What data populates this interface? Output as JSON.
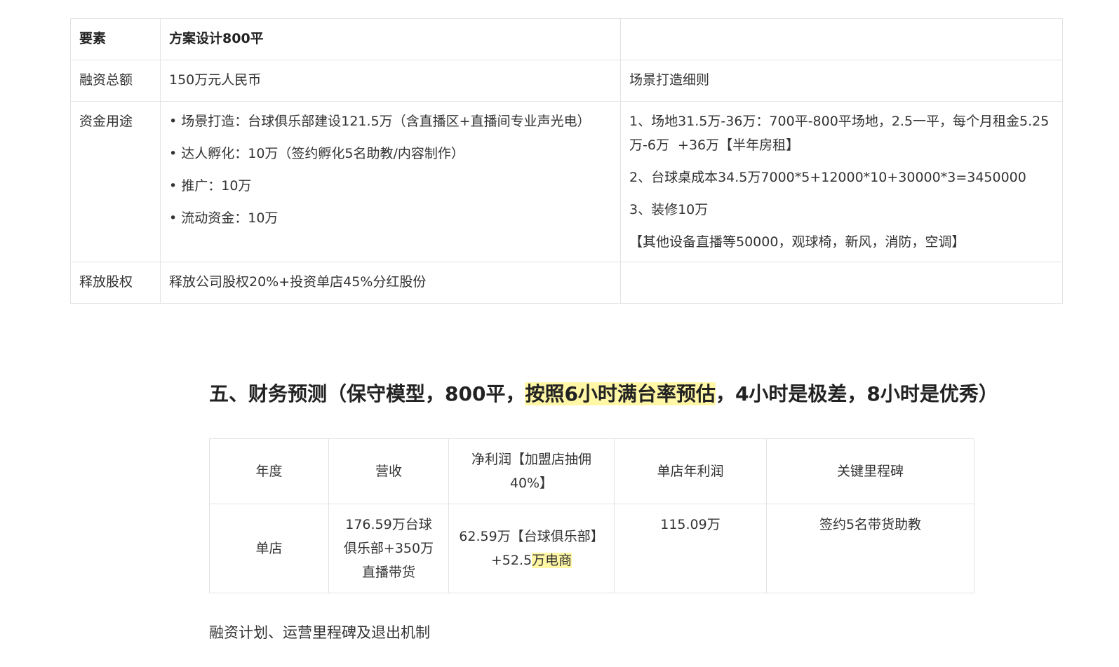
{
  "table1": {
    "header": {
      "c1": "要素",
      "c2": "方案设计800平",
      "c3": ""
    },
    "rows": {
      "total": {
        "label": "融资总额",
        "value": "150万元人民币",
        "detail": "场景打造细则"
      },
      "uses": {
        "label": "资金用途",
        "items": [
          "场景打造：台球俱乐部建设121.5万（含直播区+直播间专业声光电）",
          "达人孵化：10万（签约孵化5名助教/内容制作）",
          "推广：10万",
          "流动资金：10万"
        ],
        "details": [
          "1、场地31.5万-36万：700平-800平场地，2.5一平，每个月租金5.25万-6万  +36万【半年房租】",
          "2、台球桌成本34.5万7000*5+12000*10+30000*3=3450000",
          "3、装修10万",
          "【其他设备直播等50000，观球椅，新风，消防，空调】"
        ]
      },
      "equity": {
        "label": "释放股权",
        "value": "释放公司股权20%+投资单店45%分红股份",
        "detail": ""
      }
    }
  },
  "heading": {
    "pre": "五、财务预测（保守模型，800平，",
    "highlight": "按照6小时满台率预估",
    "post": "，4小时是极差，8小时是优秀）"
  },
  "table2": {
    "headers": [
      "年度",
      "营收",
      "净利润【加盟店抽佣40%】",
      "单店年利润",
      "关键里程碑"
    ],
    "row": {
      "year": "单店",
      "revenue": "176.59万台球俱乐部+350万直播带货",
      "profit_pre": "62.59万【台球俱乐部】+52.5",
      "profit_highlight": "万电商",
      "store_profit": "115.09万",
      "milestone": "签约5名带货助教"
    }
  },
  "footer": {
    "text": "融资计划、运营里程碑及退出机制"
  },
  "colors": {
    "highlight": "#fff7a6",
    "border": "#e3e3e3",
    "text": "#333333"
  }
}
